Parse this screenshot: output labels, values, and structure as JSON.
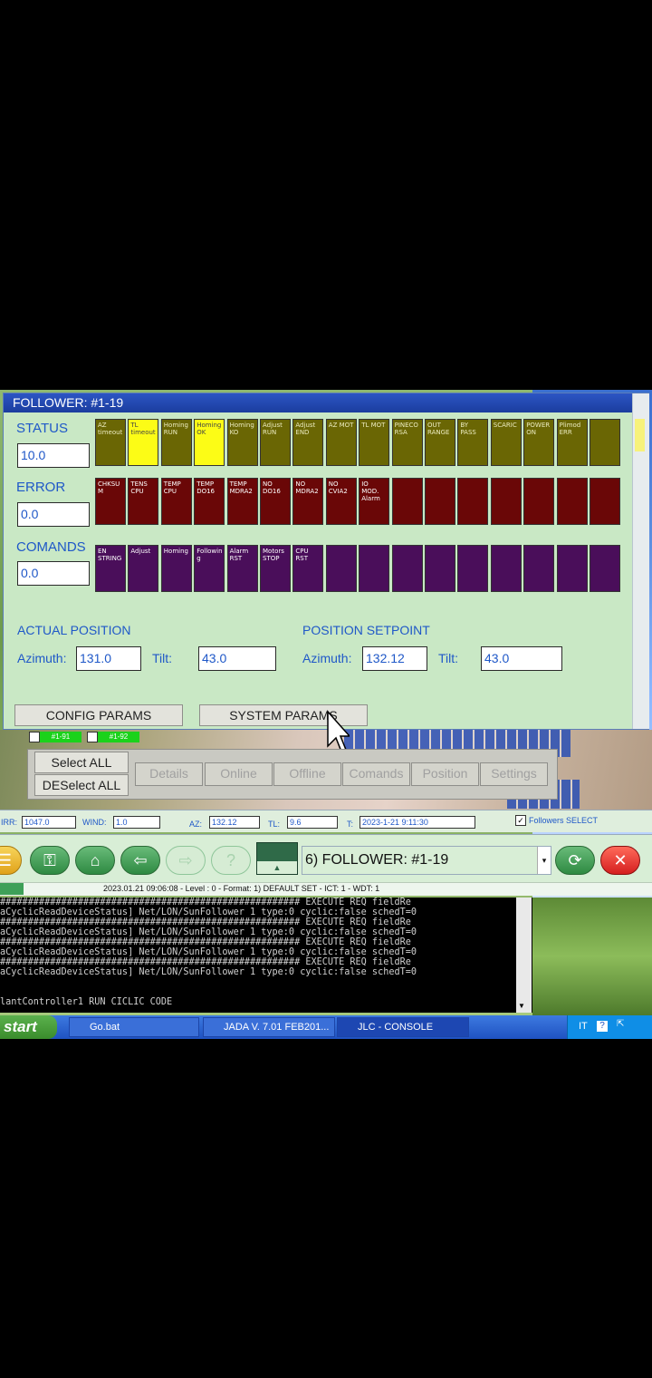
{
  "window": {
    "title": "FOLLOWER: #1-19"
  },
  "status": {
    "label": "STATUS",
    "value": "10.0",
    "cells": [
      {
        "text": "AZ timeout",
        "state": "olive"
      },
      {
        "text": "TL timeout",
        "state": "yellow"
      },
      {
        "text": "Homing RUN",
        "state": "olive"
      },
      {
        "text": "Homing OK",
        "state": "yellow"
      },
      {
        "text": "Homing KO",
        "state": "olive"
      },
      {
        "text": "Adjust RUN",
        "state": "olive"
      },
      {
        "text": "Adjust END",
        "state": "olive"
      },
      {
        "text": "AZ MOT",
        "state": "olive"
      },
      {
        "text": "TL MOT",
        "state": "olive"
      },
      {
        "text": "PINECO RSA",
        "state": "olive"
      },
      {
        "text": "OUT RANGE",
        "state": "olive"
      },
      {
        "text": "BY PASS",
        "state": "olive"
      },
      {
        "text": "SCARIC",
        "state": "olive"
      },
      {
        "text": "POWER ON",
        "state": "olive"
      },
      {
        "text": "Plimod ERR",
        "state": "olive"
      },
      {
        "text": "",
        "state": "olive"
      }
    ]
  },
  "error": {
    "label": "ERROR",
    "value": "0.0",
    "cells": [
      {
        "text": "CHKSU M"
      },
      {
        "text": "TENS CPU"
      },
      {
        "text": "TEMP CPU"
      },
      {
        "text": "TEMP DO16"
      },
      {
        "text": "TEMP MDRA2"
      },
      {
        "text": "NO DO16"
      },
      {
        "text": "NO MDRA2"
      },
      {
        "text": "NO CVIA2"
      },
      {
        "text": "IO MOD. Alarm"
      },
      {
        "text": ""
      },
      {
        "text": ""
      },
      {
        "text": ""
      },
      {
        "text": ""
      },
      {
        "text": ""
      },
      {
        "text": ""
      },
      {
        "text": ""
      }
    ]
  },
  "comands": {
    "label": "COMANDS",
    "value": "0.0",
    "cells": [
      {
        "text": "EN STRING"
      },
      {
        "text": "Adjust"
      },
      {
        "text": "Homing"
      },
      {
        "text": "Followin g"
      },
      {
        "text": "Alarm RST"
      },
      {
        "text": "Motors STOP"
      },
      {
        "text": "CPU RST"
      },
      {
        "text": ""
      },
      {
        "text": ""
      },
      {
        "text": ""
      },
      {
        "text": ""
      },
      {
        "text": ""
      },
      {
        "text": ""
      },
      {
        "text": ""
      },
      {
        "text": ""
      },
      {
        "text": ""
      }
    ]
  },
  "actual_position": {
    "title": "ACTUAL POSITION",
    "azimuth_label": "Azimuth:",
    "azimuth": "131.0",
    "tilt_label": "Tilt:",
    "tilt": "43.0"
  },
  "position_setpoint": {
    "title": "POSITION SETPOINT",
    "azimuth_label": "Azimuth:",
    "azimuth": "132.12",
    "tilt_label": "Tilt:",
    "tilt": "43.0"
  },
  "buttons": {
    "config": "CONFIG PARAMS",
    "system": "SYSTEM PARAMS"
  },
  "tags": [
    "#1-91",
    "#1-92"
  ],
  "selection": {
    "select_all": "Select ALL",
    "deselect_all": "DESelect ALL",
    "actions": [
      "Details",
      "Online",
      "Offline",
      "Comands",
      "Position",
      "Settings"
    ]
  },
  "statusline": {
    "irr_label": "IRR:",
    "irr": "1047.0",
    "wind_label": "WIND:",
    "wind": "1.0",
    "az_label": "AZ:",
    "az": "132.12",
    "tl_label": "TL:",
    "tl": "9.6",
    "t_label": "T:",
    "t": "2023-1-21 9:11:30",
    "followers_select": "Followers SELECT"
  },
  "toolbar": {
    "device_select": "6) FOLLOWER: #1-19",
    "info": "2023.01.21   09:06:08 - Level : 0 - Format: 1) DEFAULT SET - ICT: 1 - WDT: 1"
  },
  "console": {
    "lines": [
      "###################################################### EXECUTE REQ fieldRe",
      "aCyclicReadDeviceStatus] Net/LON/SunFollower 1 type:0 cyclic:false schedT=0",
      "###################################################### EXECUTE REQ fieldRe",
      "aCyclicReadDeviceStatus] Net/LON/SunFollower 1 type:0 cyclic:false schedT=0",
      "###################################################### EXECUTE REQ fieldRe",
      "aCyclicReadDeviceStatus] Net/LON/SunFollower 1 type:0 cyclic:false schedT=0",
      "###################################################### EXECUTE REQ fieldRe",
      "aCyclicReadDeviceStatus] Net/LON/SunFollower 1 type:0 cyclic:false schedT=0",
      "",
      "",
      "lantController1 RUN CICLIC CODE"
    ]
  },
  "taskbar": {
    "start": "start",
    "tasks": [
      "Go.bat",
      "JADA V. 7.01 FEB201...",
      "JLC - CONSOLE"
    ],
    "tray_lang": "IT"
  }
}
